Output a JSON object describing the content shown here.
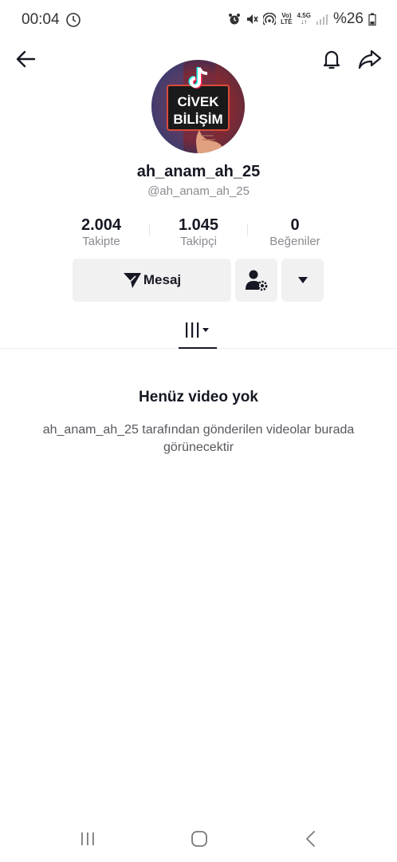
{
  "status": {
    "time": "00:04",
    "net_top": "Vo)",
    "net_bottom": "LTE",
    "gen_top": "4.5G",
    "battery": "%26"
  },
  "profile": {
    "avatar_line1": "CİVEK",
    "avatar_line2": "BİLİŞİM",
    "username": "ah_anam_ah_25",
    "handle": "@ah_anam_ah_25"
  },
  "stats": [
    {
      "value": "2.004",
      "label": "Takipte"
    },
    {
      "value": "1.045",
      "label": "Takipçi"
    },
    {
      "value": "0",
      "label": "Beğeniler"
    }
  ],
  "actions": {
    "message_label": "Mesaj"
  },
  "empty": {
    "title": "Henüz video yok",
    "description": "ah_anam_ah_25 tarafından gönderilen videolar burada görünecektir"
  },
  "colors": {
    "text_primary": "#161823",
    "text_secondary": "#8a8b91",
    "button_bg": "#f1f1f2"
  },
  "icons": {
    "back": "arrow-left-icon",
    "bell": "bell-icon",
    "share": "share-icon",
    "message": "send-icon",
    "add_user": "user-settings-icon",
    "more": "caret-down-icon",
    "videos_tab": "grid-lines-icon"
  }
}
